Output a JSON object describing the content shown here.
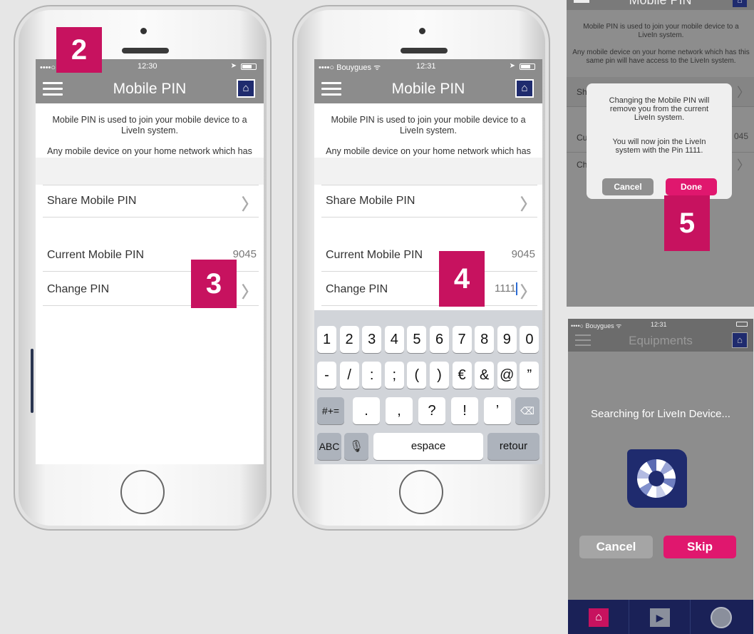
{
  "phones": [
    {
      "status": {
        "carrier": "••••○ Bouygues ᯤ",
        "time": "12:30"
      },
      "nav": {
        "title": "Mobile PIN"
      },
      "desc": {
        "line1": "Mobile PIN is used to join your mobile device to a LiveIn system.",
        "line2": "Any mobile device on your home network which has this same pin will have access to the LiveIn system."
      },
      "share": "Share Mobile PIN",
      "current_label": "Current Mobile PIN",
      "current_value": "9045",
      "change_label": "Change PIN"
    },
    {
      "status": {
        "carrier": "••••○ Bouygues ᯤ",
        "time": "12:31"
      },
      "nav": {
        "title": "Mobile PIN"
      },
      "desc": {
        "line1": "Mobile PIN is used to join your mobile device to a LiveIn system.",
        "line2": "Any mobile device on your home network which has this same pin will have access to the LiveIn system."
      },
      "share": "Share Mobile PIN",
      "current_label": "Current Mobile PIN",
      "current_value": "9045",
      "change_label": "Change PIN",
      "change_value": "1111"
    }
  ],
  "keyboard": {
    "row1": [
      "1",
      "2",
      "3",
      "4",
      "5",
      "6",
      "7",
      "8",
      "9",
      "0"
    ],
    "row2": [
      "-",
      "/",
      ":",
      ";",
      "(",
      ")",
      "€",
      "&",
      "@",
      "”"
    ],
    "row3": [
      ".",
      ",",
      "?",
      "!",
      "’"
    ],
    "shift": "#+=",
    "abc": "ABC",
    "space": "espace",
    "return": "retour"
  },
  "badges": {
    "b2": "2",
    "b3": "3",
    "b4": "4",
    "b5": "5"
  },
  "dialog_panel": {
    "title": "Mobile PIN",
    "desc1": "Mobile PIN is used to join your mobile device to a LiveIn system.",
    "desc2": "Any mobile device on your home network which has this same pin will have access to the LiveIn system.",
    "row1": "Sh",
    "row2": "Cu",
    "row2_value": "045",
    "row3": "Ch",
    "alert": {
      "line1": "Changing the Mobile PIN will remove you from the current LiveIn system.",
      "line2": "You will now join the LiveIn system with the Pin 1111.",
      "cancel": "Cancel",
      "done": "Done"
    }
  },
  "search_panel": {
    "status": {
      "carrier": "••••○ Bouygues ᯤ",
      "time": "12:31"
    },
    "title": "Equipments",
    "message": "Searching for LiveIn Device...",
    "cancel": "Cancel",
    "skip": "Skip"
  },
  "colors": {
    "accent": "#c7125f",
    "pink_button": "#e0176e",
    "header_gray": "#8c8c8c",
    "brand_navy": "#1f2b6e"
  }
}
